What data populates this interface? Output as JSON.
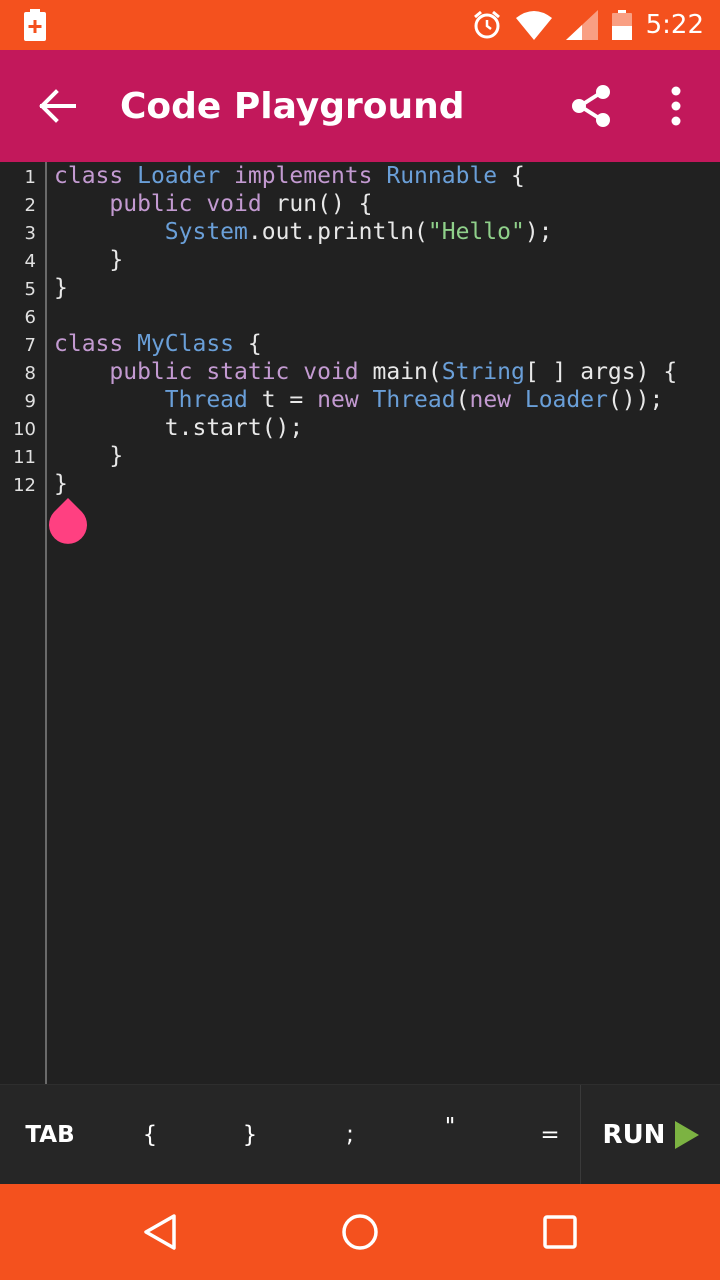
{
  "status_bar": {
    "time": "5:22",
    "icons": [
      "battery-saver-icon",
      "alarm-icon",
      "wifi-icon",
      "cell-signal-icon",
      "battery-icon"
    ]
  },
  "app_bar": {
    "title": "Code Playground",
    "icons": [
      "back-arrow-icon",
      "share-icon",
      "more-vert-icon"
    ]
  },
  "editor": {
    "line_numbers": [
      "1",
      "2",
      "3",
      "4",
      "5",
      "6",
      "7",
      "8",
      "9",
      "10",
      "11",
      "12"
    ],
    "lines": [
      [
        {
          "t": "kw",
          "v": "class "
        },
        {
          "t": "ty",
          "v": "Loader "
        },
        {
          "t": "kw",
          "v": "implements "
        },
        {
          "t": "ty",
          "v": "Runnable"
        },
        {
          "t": "pl",
          "v": " {"
        }
      ],
      [
        {
          "t": "pl",
          "v": "    "
        },
        {
          "t": "kw",
          "v": "public void "
        },
        {
          "t": "pl",
          "v": "run() {"
        }
      ],
      [
        {
          "t": "pl",
          "v": "        "
        },
        {
          "t": "ty",
          "v": "System"
        },
        {
          "t": "pl",
          "v": ".out.println("
        },
        {
          "t": "st",
          "v": "\"Hello\""
        },
        {
          "t": "pl",
          "v": ");"
        }
      ],
      [
        {
          "t": "pl",
          "v": "    }"
        }
      ],
      [
        {
          "t": "pl",
          "v": "}"
        }
      ],
      [
        {
          "t": "pl",
          "v": ""
        }
      ],
      [
        {
          "t": "kw",
          "v": "class "
        },
        {
          "t": "ty",
          "v": "MyClass"
        },
        {
          "t": "pl",
          "v": " {"
        }
      ],
      [
        {
          "t": "pl",
          "v": "    "
        },
        {
          "t": "kw",
          "v": "public static void "
        },
        {
          "t": "pl",
          "v": "main("
        },
        {
          "t": "ty",
          "v": "String"
        },
        {
          "t": "pl",
          "v": "[ ] args) {"
        }
      ],
      [
        {
          "t": "pl",
          "v": "        "
        },
        {
          "t": "ty",
          "v": "Thread"
        },
        {
          "t": "pl",
          "v": " t = "
        },
        {
          "t": "kw",
          "v": "new "
        },
        {
          "t": "ty",
          "v": "Thread"
        },
        {
          "t": "pl",
          "v": "("
        },
        {
          "t": "kw",
          "v": "new "
        },
        {
          "t": "ty",
          "v": "Loader"
        },
        {
          "t": "pl",
          "v": "());"
        }
      ],
      [
        {
          "t": "pl",
          "v": "        t.start();"
        }
      ],
      [
        {
          "t": "pl",
          "v": "    }"
        }
      ],
      [
        {
          "t": "pl",
          "v": "}"
        }
      ]
    ]
  },
  "shortcut_bar": {
    "keys": [
      "TAB",
      "{",
      "}",
      ";",
      "\"",
      "="
    ],
    "run_label": "RUN"
  },
  "nav_bar": {
    "icons": [
      "back-triangle-icon",
      "home-circle-icon",
      "recents-square-icon"
    ]
  },
  "colors": {
    "status_bar": "#f4511e",
    "app_bar": "#c2185b",
    "editor_bg": "#212121",
    "keyword": "#c39ad1",
    "type": "#6a9fd8",
    "string": "#8fd08a",
    "cursor_handle": "#ff4081",
    "run_play": "#7cb342"
  }
}
